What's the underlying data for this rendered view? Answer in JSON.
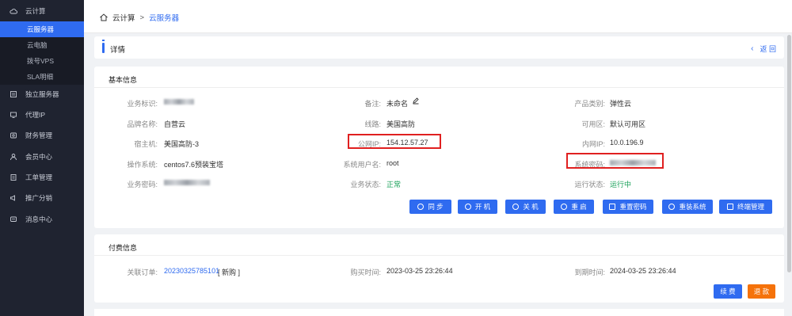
{
  "sidebar": {
    "group": "云计算",
    "subitems": [
      "云服务器",
      "云电脑",
      "拨号VPS",
      "SLA明细"
    ],
    "items": [
      "独立服务器",
      "代理IP",
      "财务管理",
      "会员中心",
      "工单管理",
      "推广分销",
      "消息中心"
    ]
  },
  "breadcrumb": {
    "root": "云计算",
    "sep": ">",
    "current": "云服务器"
  },
  "detail": {
    "title": "详情",
    "back": "返 回"
  },
  "basic": {
    "title": "基本信息",
    "fields": {
      "biz_id_label": "业务标识:",
      "biz_id_value": "",
      "note_label": "备注:",
      "note_value": "未命名",
      "category_label": "产品类别:",
      "category_value": "弹性云",
      "brand_label": "品牌名称:",
      "brand_value": "自营云",
      "line_label": "线路:",
      "line_value": "美国高防",
      "zone_label": "可用区:",
      "zone_value": "默认可用区",
      "host_label": "宿主机:",
      "host_value": "美国高防-3",
      "public_ip_label": "公网IP:",
      "public_ip_value": "154.12.57.27",
      "private_ip_label": "内网IP:",
      "private_ip_value": "10.0.196.9",
      "os_label": "操作系统:",
      "os_value": "centos7.6预装宝塔",
      "sys_user_label": "系统用户名:",
      "sys_user_value": "root",
      "sys_pwd_label": "系统密码:",
      "sys_pwd_value": "",
      "biz_pwd_label": "业务密码:",
      "biz_pwd_value": "",
      "biz_status_label": "业务状态:",
      "biz_status_value": "正常",
      "run_status_label": "运行状态:",
      "run_status_value": "运行中"
    },
    "buttons": [
      "同 步",
      "开 机",
      "关 机",
      "重 启",
      "重置密码",
      "重装系统",
      "终端管理"
    ]
  },
  "pay": {
    "title": "付费信息",
    "order_label": "关联订单:",
    "order_value": "20230325785101",
    "order_tag": "[ 新购 ]",
    "buy_label": "购买时间:",
    "buy_value": "2023-03-25 23:26:44",
    "expire_label": "到期时间:",
    "expire_value": "2024-03-25 23:26:44",
    "renew": "续 费",
    "refund": "退 款"
  },
  "colors": {
    "primary": "#2f6bf0",
    "warning": "#f5720a",
    "sidebar": "#1f2330",
    "highlight": "#e02020"
  }
}
